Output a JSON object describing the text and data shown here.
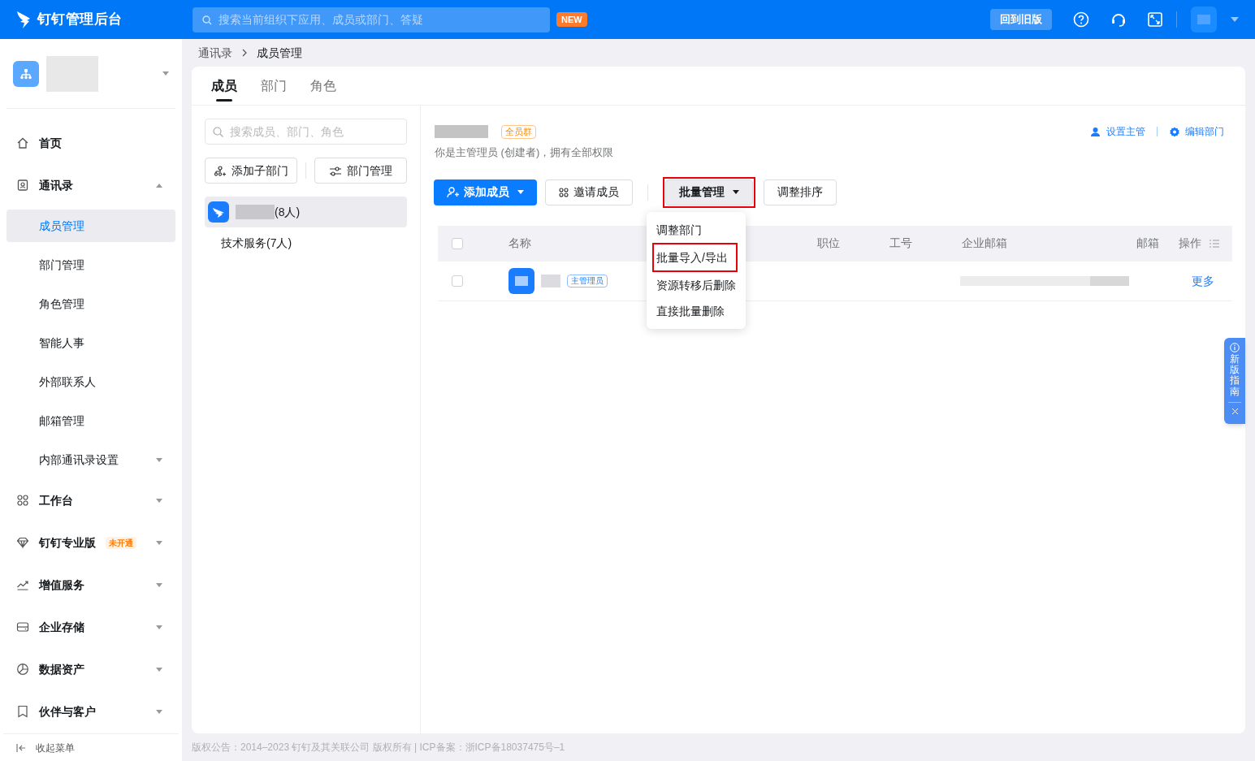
{
  "header": {
    "logo_text": "钉钉管理后台",
    "search_placeholder": "搜索当前组织下应用、成员或部门、答疑",
    "new_badge": "NEW",
    "old_version_button": "回到旧版"
  },
  "sidebar": {
    "items": [
      {
        "label": "首页",
        "kind": "link"
      },
      {
        "label": "通讯录",
        "kind": "group",
        "expanded": true,
        "children": [
          {
            "label": "成员管理",
            "kind": "link",
            "selected": true
          },
          {
            "label": "部门管理",
            "kind": "link",
            "selected": false
          },
          {
            "label": "角色管理",
            "kind": "link",
            "selected": false
          },
          {
            "label": "智能人事",
            "kind": "link",
            "selected": false
          },
          {
            "label": "外部联系人",
            "kind": "link",
            "selected": false
          },
          {
            "label": "邮箱管理",
            "kind": "link",
            "selected": false
          },
          {
            "label": "内部通讯录设置",
            "kind": "group",
            "expanded": false,
            "selected": false
          }
        ]
      },
      {
        "label": "工作台",
        "kind": "group",
        "expanded": false
      },
      {
        "label": "钉钉专业版",
        "kind": "group",
        "expanded": false,
        "badge": "未开通"
      },
      {
        "label": "增值服务",
        "kind": "group",
        "expanded": false
      },
      {
        "label": "企业存储",
        "kind": "group",
        "expanded": false
      },
      {
        "label": "数据资产",
        "kind": "group",
        "expanded": false
      },
      {
        "label": "伙伴与客户",
        "kind": "group",
        "expanded": false
      }
    ],
    "collapse_label": "收起菜单"
  },
  "breadcrumb": [
    "通讯录",
    "成员管理"
  ],
  "tabs": [
    {
      "label": "成员",
      "selected": true
    },
    {
      "label": "部门",
      "selected": false
    },
    {
      "label": "角色",
      "selected": false
    }
  ],
  "dept_panel": {
    "search_placeholder": "搜索成员、部门、角色",
    "buttons": [
      "添加子部门",
      "部门管理"
    ],
    "tree": [
      {
        "label": "(8人)",
        "kind": "root",
        "selected": true
      },
      {
        "label": "技术服务(7人)",
        "kind": "dept",
        "selected": false
      }
    ]
  },
  "dept_header": {
    "tag": "全员群",
    "description": "你是主管理员 (创建者)，拥有全部权限",
    "actions": [
      "设置主管",
      "编辑部门"
    ]
  },
  "toolbar": [
    {
      "label": "添加成员",
      "kind": "primary",
      "highlighted": false
    },
    {
      "label": "邀请成员",
      "kind": "invite",
      "highlighted": false
    },
    {
      "label": "批量管理",
      "kind": "dropdown",
      "highlighted": true
    },
    {
      "label": "调整排序",
      "kind": "plain",
      "highlighted": false
    }
  ],
  "dropdown_menu": [
    {
      "label": "调整部门",
      "highlighted": false
    },
    {
      "label": "批量导入/导出",
      "highlighted": true
    },
    {
      "label": "资源转移后删除",
      "highlighted": false
    },
    {
      "label": "直接批量删除",
      "highlighted": false
    }
  ],
  "table": {
    "select_all_checked": false,
    "columns": [
      "名称",
      "职位",
      "工号",
      "企业邮箱",
      "邮箱",
      "操作"
    ],
    "rows": [
      {
        "checked": false,
        "role_tag": "主管理员",
        "action": "更多"
      }
    ]
  },
  "guide": {
    "label": "新版指南"
  },
  "footer": "版权公告：2014–2023 钉钉及其关联公司 版权所有 | ICP备案：浙ICP备18037475号–1"
}
